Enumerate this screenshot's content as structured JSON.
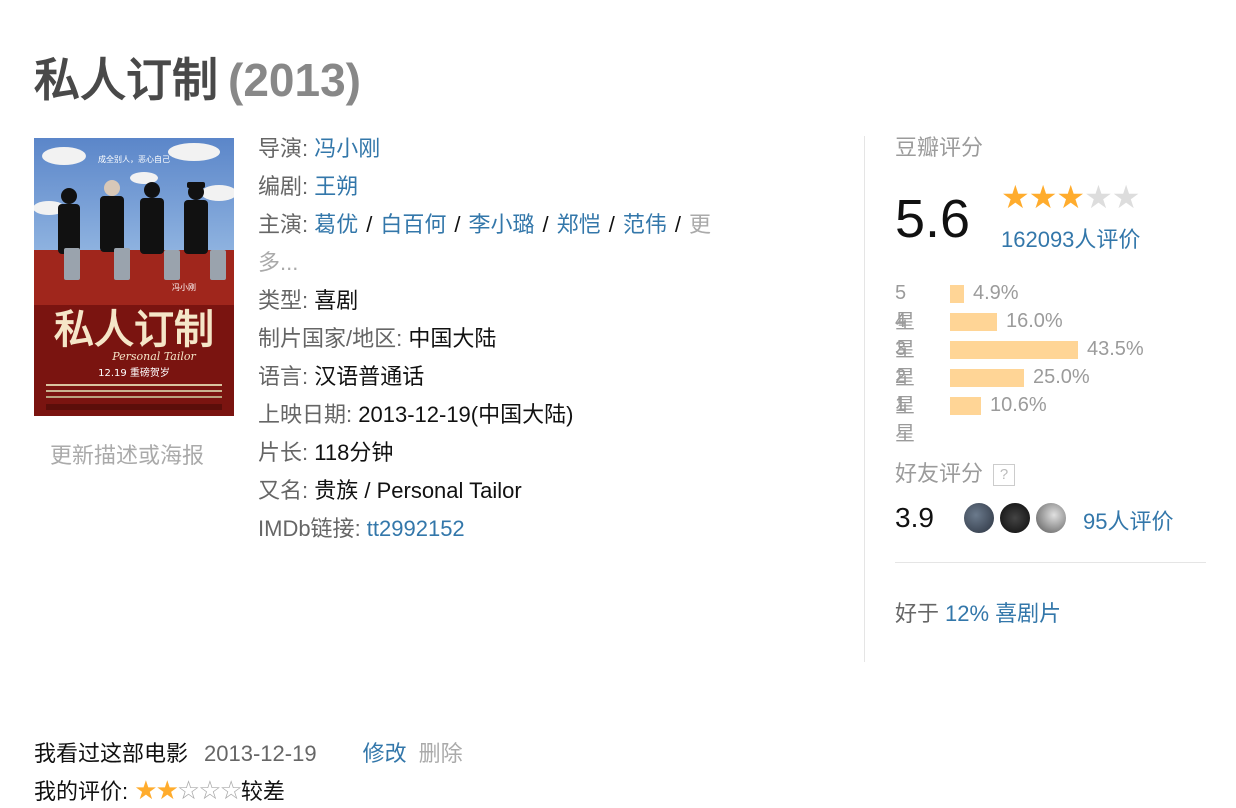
{
  "movie": {
    "title": "私人订制",
    "year": "(2013)"
  },
  "poster": {
    "tagline": "成全别人，恶心自己",
    "title_cn": "私人订制",
    "title_en": "Personal Tailor",
    "release": "12.19 重磅贺岁",
    "director_tag": "冯小刚",
    "update_link": "更新描述或海报"
  },
  "info": {
    "director_label": "导演",
    "director": "冯小刚",
    "writer_label": "编剧",
    "writer": "王朔",
    "cast_label": "主演",
    "cast": [
      "葛优",
      "白百何",
      "李小璐",
      "郑恺",
      "范伟"
    ],
    "cast_more": "更多...",
    "genre_label": "类型",
    "genre": "喜剧",
    "country_label": "制片国家/地区",
    "country": "中国大陆",
    "language_label": "语言",
    "language": "汉语普通话",
    "release_label": "上映日期",
    "release": "2013-12-19(中国大陆)",
    "runtime_label": "片长",
    "runtime": "118分钟",
    "aka_label": "又名",
    "aka": "贵族 / Personal Tailor",
    "imdb_label": "IMDb链接",
    "imdb": "tt2992152"
  },
  "rating": {
    "section_title": "豆瓣评分",
    "score": "5.6",
    "stars": 3,
    "votes": "162093人评价",
    "distribution": [
      {
        "label": "5星",
        "pct_text": "4.9%",
        "pct": 4.9
      },
      {
        "label": "4星",
        "pct_text": "16.0%",
        "pct": 16.0
      },
      {
        "label": "3星",
        "pct_text": "43.5%",
        "pct": 43.5
      },
      {
        "label": "2星",
        "pct_text": "25.0%",
        "pct": 25.0
      },
      {
        "label": "1星",
        "pct_text": "10.6%",
        "pct": 10.6
      }
    ],
    "friend_title": "好友评分",
    "help_icon": "?",
    "friend_score": "3.9",
    "friend_votes": "95人评价",
    "better_than_prefix": "好于",
    "better_than": "12% 喜剧片"
  },
  "my": {
    "seen_text": "我看过这部电影",
    "seen_date": "2013-12-19",
    "edit": "修改",
    "delete": "删除",
    "rating_label": "我的评价:",
    "my_stars": 2,
    "rating_text": "较差"
  },
  "colors": {
    "link": "#3377aa",
    "star": "#ffac2d",
    "bar": "#ffd596",
    "muted": "#9b9b9b"
  }
}
